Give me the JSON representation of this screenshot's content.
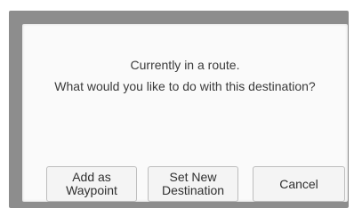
{
  "dialog": {
    "message_line_1": "Currently in a route.",
    "message_line_2": "What would you like to do with this destination?",
    "buttons": {
      "add_waypoint": {
        "line_1": "Add as",
        "line_2": "Waypoint"
      },
      "set_destination": {
        "line_1": "Set New",
        "line_2": "Destination"
      },
      "cancel": "Cancel"
    }
  },
  "colors": {
    "frame": "#8d8d8d",
    "panel": "#fafafa",
    "button_bg": "#f4f4f4",
    "text": "#3a3a3a"
  }
}
